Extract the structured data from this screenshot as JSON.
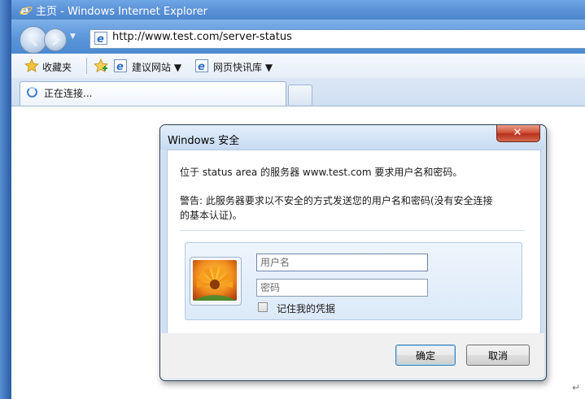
{
  "window": {
    "title": "主页 - Windows Internet Explorer"
  },
  "address_bar": {
    "url": "http://www.test.com/server-status"
  },
  "favorites_bar": {
    "favorites_label": "收藏夹",
    "items": [
      {
        "label": "建议网站 ▼"
      },
      {
        "label": "网页快讯库 ▼"
      }
    ]
  },
  "tab": {
    "label": "正在连接..."
  },
  "dialog": {
    "title": "Windows 安全",
    "close_symbol": "✕",
    "message": "位于 status area 的服务器 www.test.com 要求用户名和密码。",
    "warning_line1": "警告: 此服务器要求以不安全的方式发送您的用户名和密码(没有安全连接",
    "warning_line2": "的基本认证)。",
    "username": {
      "placeholder": "用户名",
      "value": ""
    },
    "password": {
      "placeholder": "密码",
      "value": ""
    },
    "remember_label": "记住我的凭据",
    "ok_label": "确定",
    "cancel_label": "取消"
  },
  "page": {
    "corner_mark": "↵"
  }
}
